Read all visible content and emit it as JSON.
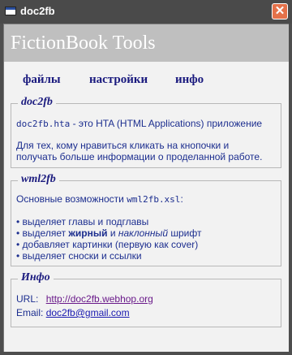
{
  "window": {
    "title": "doc2fb",
    "close_glyph": "✕"
  },
  "banner": {
    "title": "FictionBook Tools"
  },
  "menu": {
    "items": [
      "файлы",
      "настройки",
      "инфо"
    ]
  },
  "doc2fb": {
    "legend": "doc2fb",
    "line1_code": "doc2fb.hta",
    "line1_rest": " - это HTA (HTML Applications) приложение",
    "line2": "Для тех, кому нравиться кликать на кнопочки и",
    "line3": "получать больше информации о проделанной работе."
  },
  "wml2fb": {
    "legend": "wml2fb",
    "intro_a": "Основные возможности ",
    "intro_code": "wml2fb.xsl",
    "intro_b": ":",
    "bullet1": "• выделяет главы и подглавы",
    "bullet2_a": "• выделяет ",
    "bullet2_bold": "жирный",
    "bullet2_b": " и ",
    "bullet2_italic": "наклонный",
    "bullet2_c": " шрифт",
    "bullet3": "• добавляет картинки (первую как cover)",
    "bullet4": "• выделяет сноски и ссылки"
  },
  "info": {
    "legend": "Инфо",
    "url_label": "URL:",
    "url": "http://doc2fb.webhop.org",
    "email_label": "Email:",
    "email": "doc2fb@gmail.com"
  }
}
